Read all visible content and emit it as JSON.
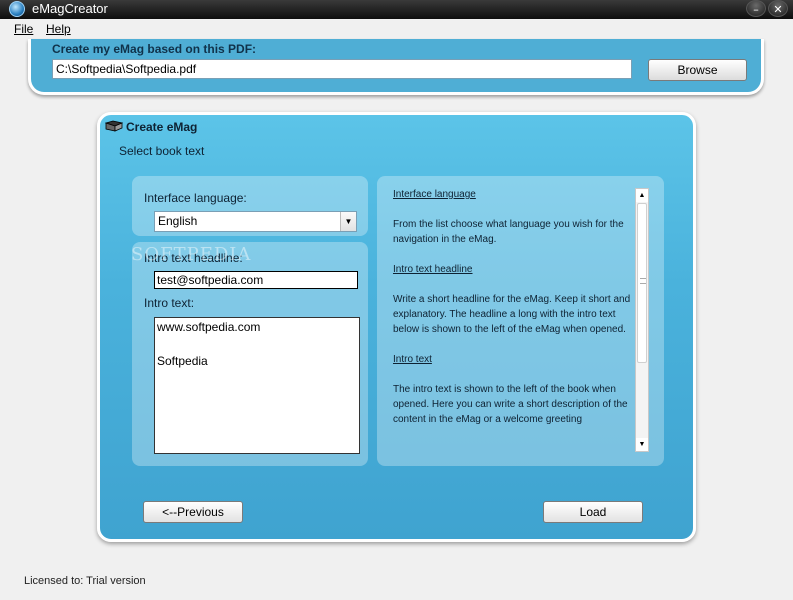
{
  "window": {
    "title": "eMagCreator",
    "minimize_glyph": "–",
    "close_glyph": "✕"
  },
  "menu": {
    "file": "File",
    "help": "Help"
  },
  "pdf_section": {
    "label": "Create my eMag based on this PDF:",
    "path": "C:\\Softpedia\\Softpedia.pdf",
    "browse_label": "Browse"
  },
  "create_panel": {
    "title": "Create eMag",
    "subtitle": "Select book text",
    "interface_language_label": "Interface language:",
    "language_value": "English",
    "intro_headline_label": "Intro text headline:",
    "intro_headline_value": "test@softpedia.com",
    "intro_text_label": "Intro text:",
    "intro_text_lines": [
      "www.softpedia.com",
      "",
      "Softpedia"
    ],
    "help": [
      {
        "heading": "Interface language",
        "body": "From the list choose what language you wish for the navigation in the eMag."
      },
      {
        "heading": "Intro text headline",
        "body": "Write a short headline for the eMag. Keep it short and explanatory. The headline a long with the intro text below is shown to the left of the eMag when opened."
      },
      {
        "heading": "Intro text",
        "body": "The intro text is shown to the left of the book when opened. Here you can write a short description of the content in the eMag or a welcome greeting"
      }
    ],
    "previous_label": "<--Previous",
    "load_label": "Load"
  },
  "watermark": "SOFTPEDIA",
  "status": "Licensed to: Trial version",
  "colors": {
    "panel_blue": "#4faed5",
    "title_bar": "#1a1a1a"
  }
}
